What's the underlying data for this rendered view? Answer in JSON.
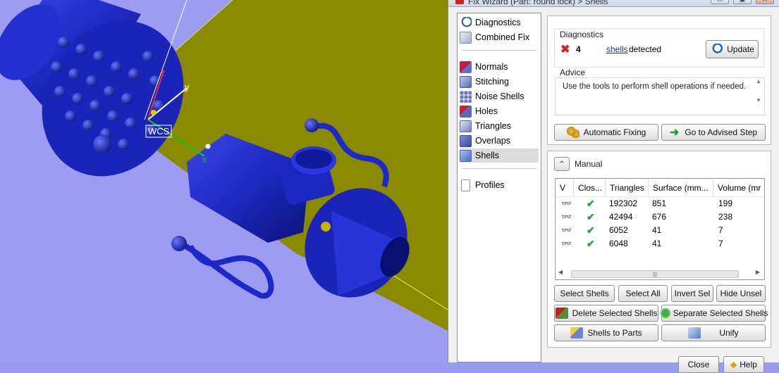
{
  "window": {
    "title": "Fix Wizard (Part: round lock) > Shells",
    "minimize_label": "▭",
    "maximize_label": "▣",
    "close_label": "✕"
  },
  "viewport": {
    "wcs_label": "WCS",
    "axis_y": "y",
    "axis_z": "z",
    "axis_x": "x"
  },
  "steps": {
    "top": [
      {
        "label": "Diagnostics",
        "icon": "magnifier-icon"
      },
      {
        "label": "Combined Fix",
        "icon": "cube-icon"
      }
    ],
    "mid": [
      {
        "label": "Normals",
        "icon": "normals-icon"
      },
      {
        "label": "Stitching",
        "icon": "stitching-icon"
      },
      {
        "label": "Noise Shells",
        "icon": "noise-shells-icon"
      },
      {
        "label": "Holes",
        "icon": "holes-icon"
      },
      {
        "label": "Triangles",
        "icon": "triangles-icon"
      },
      {
        "label": "Overlaps",
        "icon": "overlaps-icon"
      },
      {
        "label": "Shells",
        "icon": "shells-icon",
        "selected": true
      }
    ],
    "bottom": [
      {
        "label": "Profiles",
        "icon": "document-icon"
      }
    ]
  },
  "diagnostics": {
    "heading": "Diagnostics",
    "count": "4",
    "link": "shells",
    "suffix": "detected",
    "update_label": "Update"
  },
  "advice": {
    "heading": "Advice",
    "text": "Use the tools to perform shell operations if needed."
  },
  "actions": {
    "automatic_fixing": "Automatic Fixing",
    "advised_step": "Go to Advised Step"
  },
  "manual": {
    "heading": "Manual",
    "columns": [
      "V",
      "Clos...",
      "Triangles",
      "Surface (mm...",
      "Volume (mr"
    ],
    "rows": [
      {
        "triangles": "192302",
        "surface": "851",
        "volume": "199"
      },
      {
        "triangles": "42494",
        "surface": "676",
        "volume": "238"
      },
      {
        "triangles": "6052",
        "surface": "41",
        "volume": "7"
      },
      {
        "triangles": "6048",
        "surface": "41",
        "volume": "7"
      }
    ],
    "buttons": {
      "select_shells": "Select Shells",
      "select_all": "Select All",
      "invert_sel": "Invert Sel",
      "hide_unsel": "Hide Unsel",
      "delete_selected": "Delete Selected Shells",
      "separate_selected": "Separate Selected Shells",
      "shells_to_parts": "Shells to Parts",
      "unify": "Unify"
    }
  },
  "footer": {
    "close_label": "Close",
    "help_label": "Help"
  },
  "colors": {
    "model": "#1e28c8",
    "plate": "#8a8a00",
    "viewport_bg": "#9c9cf2",
    "check": "#2aa02a"
  }
}
